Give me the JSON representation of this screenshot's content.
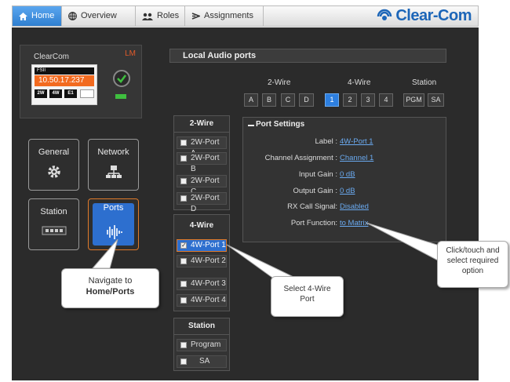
{
  "nav": {
    "tabs": [
      {
        "label": "Home",
        "icon": "home-icon",
        "active": true
      },
      {
        "label": "Overview",
        "icon": "globe-icon",
        "active": false
      },
      {
        "label": "Roles",
        "icon": "users-icon",
        "active": false
      },
      {
        "label": "Assignments",
        "icon": "assignments-icon",
        "active": false
      }
    ],
    "brand": "Clear-Com"
  },
  "device": {
    "title": "ClearCom",
    "badge": "LM",
    "model": "FSII",
    "ip": "10.50.17.237",
    "buttons": [
      "2W",
      "4W",
      "E1"
    ]
  },
  "tiles": {
    "general": "General",
    "network": "Network",
    "station": "Station",
    "ports": "Ports"
  },
  "panel": {
    "title": "Local Audio ports",
    "groups": {
      "two_wire": "2-Wire",
      "four_wire": "4-Wire",
      "station": "Station"
    },
    "two_wire_buttons": [
      "A",
      "B",
      "C",
      "D"
    ],
    "four_wire_buttons": [
      "1",
      "2",
      "3",
      "4"
    ],
    "station_buttons": [
      "PGM",
      "SA"
    ]
  },
  "port_list": {
    "two_wire_head": "2-Wire",
    "two_wire": [
      "2W-Port A",
      "2W-Port B",
      "2W-Port C",
      "2W-Port D"
    ],
    "four_wire_head": "4-Wire",
    "four_wire": [
      "4W-Port 1",
      "4W-Port 2",
      "4W-Port 3",
      "4W-Port 4"
    ],
    "station_head": "Station",
    "station": [
      "Program",
      "SA"
    ]
  },
  "settings": {
    "heading": "Port Settings",
    "rows": [
      {
        "key": "Label :",
        "value": "4W-Port 1"
      },
      {
        "key": "Channel Assignment :",
        "value": "Channel 1"
      },
      {
        "key": "Input Gain :",
        "value": "0 dB"
      },
      {
        "key": "Output Gain :",
        "value": "0 dB"
      },
      {
        "key": "RX Call Signal:",
        "value": "Disabled"
      },
      {
        "key": "Port Function:",
        "value": "to Matrix"
      }
    ]
  },
  "callouts": {
    "navigate_line1": "Navigate to",
    "navigate_line2": "Home/Ports",
    "select_4wire_line1": "Select 4-Wire",
    "select_4wire_line2": "Port",
    "click_touch_line1": "Click/touch and",
    "click_touch_line2": "select required",
    "click_touch_line3": "option"
  },
  "colors": {
    "accent_blue": "#2d7fe0",
    "selection_orange": "#e07a2a",
    "ip_orange": "#f26a1f",
    "link_blue": "#6aaaf0"
  }
}
